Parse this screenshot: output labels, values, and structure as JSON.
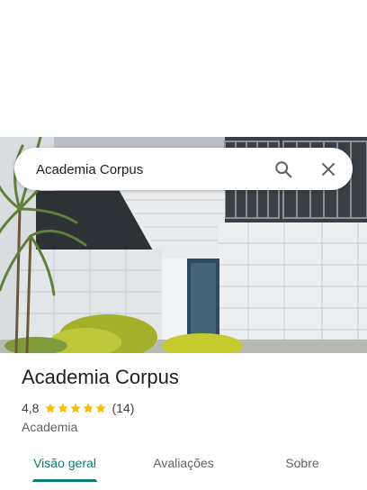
{
  "search": {
    "value": "Academia Corpus"
  },
  "place": {
    "name": "Academia Corpus",
    "rating": "4,8",
    "stars": 5,
    "review_count": "(14)",
    "category": "Academia"
  },
  "tabs": [
    {
      "label": "Visão geral",
      "active": true
    },
    {
      "label": "Avaliações",
      "active": false
    },
    {
      "label": "Sobre",
      "active": false
    }
  ],
  "colors": {
    "accent": "#0b7d6e",
    "star": "#fbbc04",
    "title": "#202124"
  },
  "icons": {
    "search": "search-icon",
    "close": "close-icon"
  }
}
